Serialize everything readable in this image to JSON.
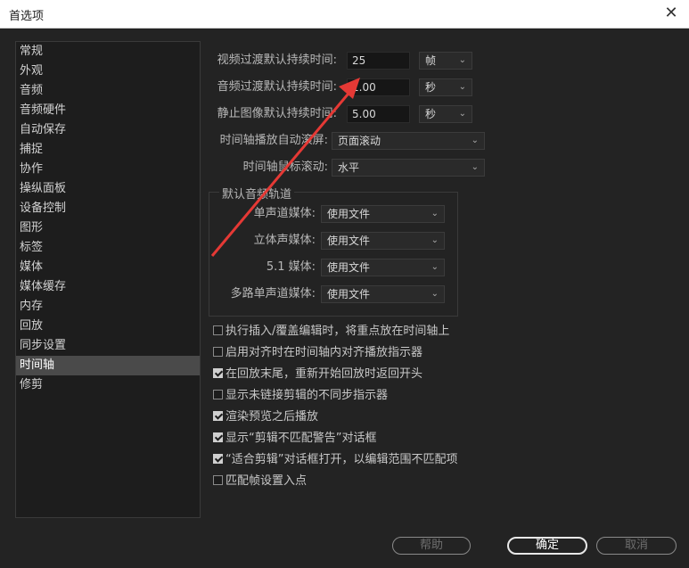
{
  "window": {
    "title": "首选项",
    "close_glyph": "✕"
  },
  "sidebar": {
    "items": [
      "常规",
      "外观",
      "音频",
      "音频硬件",
      "自动保存",
      "捕捉",
      "协作",
      "操纵面板",
      "设备控制",
      "图形",
      "标签",
      "媒体",
      "媒体缓存",
      "内存",
      "回放",
      "同步设置",
      "时间轴",
      "修剪"
    ],
    "active_index": 16
  },
  "settings": {
    "video_transition": {
      "label": "视频过渡默认持续时间:",
      "value": "25",
      "unit": "帧"
    },
    "audio_transition": {
      "label": "音频过渡默认持续时间:",
      "value": "1.00",
      "unit": "秒"
    },
    "still_image": {
      "label": "静止图像默认持续时间:",
      "value": "5.00",
      "unit": "秒"
    },
    "timeline_autoscroll": {
      "label": "时间轴播放自动滚屏:",
      "value": "页面滚动"
    },
    "timeline_mousescroll": {
      "label": "时间轴鼠标滚动:",
      "value": "水平"
    }
  },
  "audio_tracks": {
    "title": "默认音频轨道",
    "rows": [
      {
        "label": "单声道媒体:",
        "value": "使用文件"
      },
      {
        "label": "立体声媒体:",
        "value": "使用文件"
      },
      {
        "label": "5.1 媒体:",
        "value": "使用文件"
      },
      {
        "label": "多路单声道媒体:",
        "value": "使用文件"
      }
    ]
  },
  "checkboxes": [
    {
      "label": "执行插入/覆盖编辑时，将重点放在时间轴上",
      "checked": false
    },
    {
      "label": "启用对齐时在时间轴内对齐播放指示器",
      "checked": false
    },
    {
      "label": "在回放末尾，重新开始回放时返回开头",
      "checked": true
    },
    {
      "label": "显示未链接剪辑的不同步指示器",
      "checked": false
    },
    {
      "label": "渲染预览之后播放",
      "checked": true
    },
    {
      "label": "显示“剪辑不匹配警告”对话框",
      "checked": true
    },
    {
      "label": "“适合剪辑”对话框打开，以编辑范围不匹配项",
      "checked": true
    },
    {
      "label": "匹配帧设置入点",
      "checked": false
    }
  ],
  "buttons": {
    "help": "帮助",
    "ok": "确定",
    "cancel": "取消"
  },
  "colors": {
    "background": "#232323",
    "annotation_arrow": "#e53935",
    "active_item": "#4a4a4a"
  }
}
